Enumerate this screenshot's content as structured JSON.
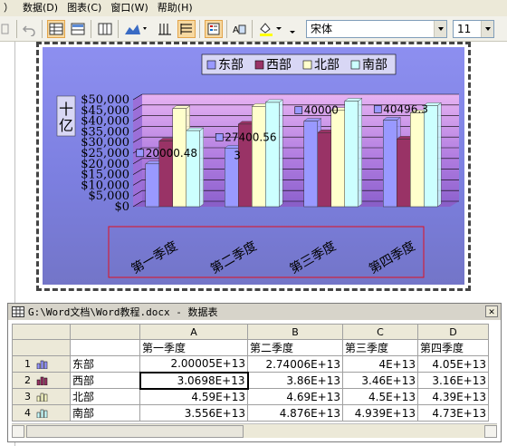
{
  "menu": {
    "items": [
      "）",
      "数据(D)",
      "图表(C)",
      "窗口(W)",
      "帮助(H)"
    ]
  },
  "toolbar": {
    "font_name": "宋体",
    "font_size": "11"
  },
  "chart_data": {
    "type": "bar",
    "categories": [
      "第一季度",
      "第二季度",
      "第三季度",
      "第四季度"
    ],
    "series": [
      {
        "name": "东部",
        "color": "#9999ff",
        "values": [
          20000.48,
          27400.56,
          40000,
          40496.3
        ]
      },
      {
        "name": "西部",
        "color": "#993366",
        "values": [
          30698,
          38600,
          34600,
          31600
        ]
      },
      {
        "name": "北部",
        "color": "#ffffcc",
        "values": [
          45900,
          46900,
          45000,
          43900
        ]
      },
      {
        "name": "南部",
        "color": "#ccffff",
        "values": [
          35560,
          48760,
          49390,
          47300
        ]
      }
    ],
    "data_labels": [
      "20000.48",
      "27400.56",
      "40000",
      "40496.3"
    ],
    "data_label_overflow": "3",
    "ylabel": "十亿",
    "yticks": [
      "$0",
      "$5,000",
      "$10,000",
      "$15,000",
      "$20,000",
      "$25,000",
      "$30,000",
      "$35,000",
      "$40,000",
      "$45,000",
      "$50,000"
    ],
    "ylim": [
      0,
      50000
    ],
    "legend_position": "top",
    "grid": true
  },
  "datasheet": {
    "title": "G:\\Word文档\\Word教程.docx - 数据表",
    "columns": [
      "A",
      "B",
      "C",
      "D"
    ],
    "headers": [
      "第一季度",
      "第二季度",
      "第三季度",
      "第四季度"
    ],
    "rows": [
      {
        "num": "1",
        "label": "东部",
        "values": [
          "2.00005E+13",
          "2.74006E+13",
          "4E+13",
          "4.05E+13"
        ]
      },
      {
        "num": "2",
        "label": "西部",
        "values": [
          "3.0698E+13",
          "3.86E+13",
          "3.46E+13",
          "3.16E+13"
        ]
      },
      {
        "num": "3",
        "label": "北部",
        "values": [
          "4.59E+13",
          "4.69E+13",
          "4.5E+13",
          "4.39E+13"
        ]
      },
      {
        "num": "4",
        "label": "南部",
        "values": [
          "3.556E+13",
          "4.876E+13",
          "4.939E+13",
          "4.73E+13"
        ]
      }
    ]
  }
}
